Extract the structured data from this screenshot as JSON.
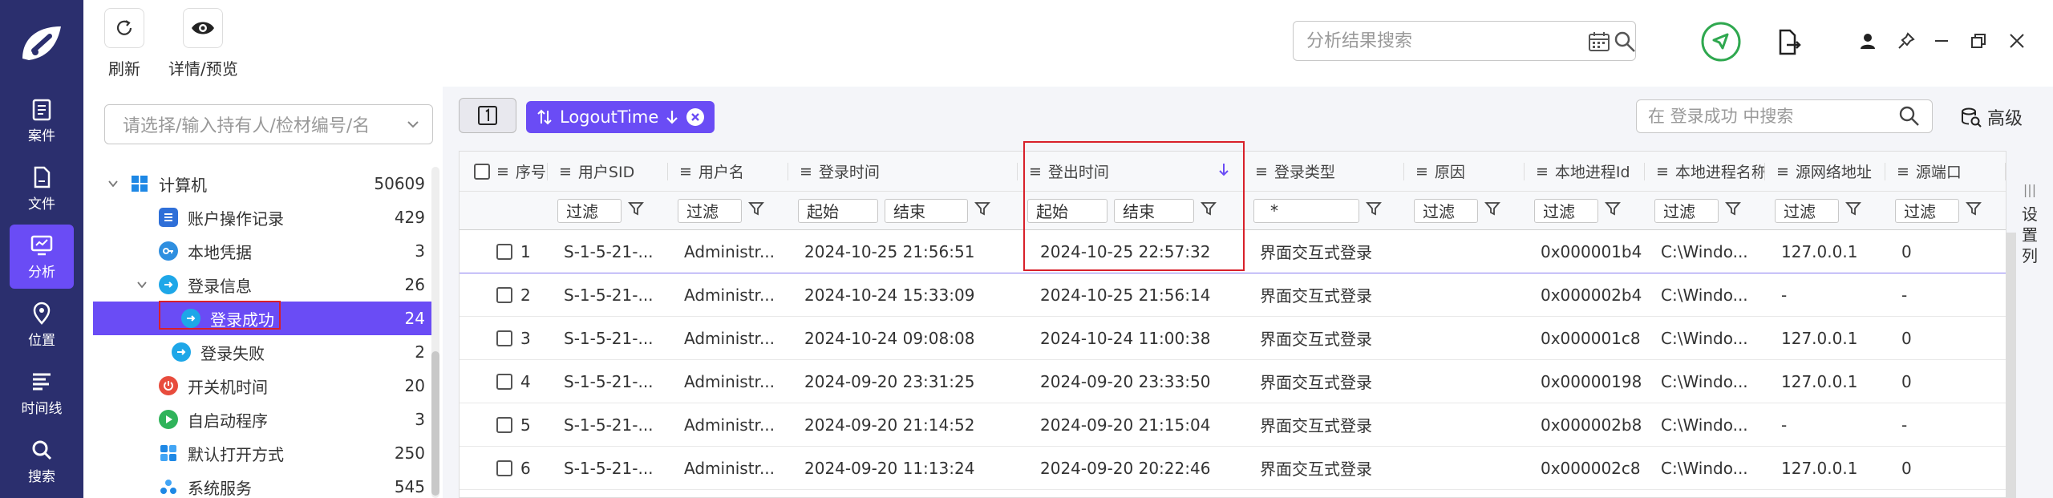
{
  "nav": {
    "items": [
      {
        "label": "案件",
        "icon": "clipboard-icon"
      },
      {
        "label": "文件",
        "icon": "file-icon"
      },
      {
        "label": "分析",
        "icon": "monitor-icon",
        "active": true
      },
      {
        "label": "位置",
        "icon": "location-icon"
      },
      {
        "label": "时间线",
        "icon": "timeline-icon"
      },
      {
        "label": "搜索",
        "icon": "search-icon"
      }
    ]
  },
  "toolbar": {
    "refresh_label": "刷新",
    "detail_label": "详情/预览",
    "search_placeholder": "分析结果搜索"
  },
  "tree": {
    "selector_placeholder": "请选择/输入持有人/检材编号/名",
    "items": [
      {
        "label": "计算机",
        "count": "50609"
      },
      {
        "label": "账户操作记录",
        "count": "429"
      },
      {
        "label": "本地凭据",
        "count": "3"
      },
      {
        "label": "登录信息",
        "count": "26"
      },
      {
        "label": "登录成功",
        "count": "24"
      },
      {
        "label": "登录失败",
        "count": "2"
      },
      {
        "label": "开关机时间",
        "count": "20"
      },
      {
        "label": "自启动程序",
        "count": "3"
      },
      {
        "label": "默认打开方式",
        "count": "250"
      },
      {
        "label": "系统服务",
        "count": "545"
      }
    ]
  },
  "filterbar": {
    "sort_chip_label": "LogoutTime",
    "table_search_placeholder": "在 登录成功 中搜索",
    "advanced_label": "高级"
  },
  "table": {
    "headers": [
      "序号",
      "用户SID",
      "用户名",
      "登录时间",
      "登出时间",
      "登录类型",
      "原因",
      "本地进程Id",
      "本地进程名称",
      "源网络地址",
      "源端口"
    ],
    "filters": {
      "text": "过滤",
      "start": "起始",
      "end": "结束",
      "logon_type": "*"
    },
    "rows": [
      {
        "no": "1",
        "sid": "S-1-5-21-...",
        "user": "Administr...",
        "login": "2024-10-25 21:56:51",
        "logout": "2024-10-25 22:57:32",
        "type": "界面交互式登录",
        "reason": "",
        "pid": "0x000001b4",
        "pname": "C:\\Windo...",
        "addr": "127.0.0.1",
        "port": "0"
      },
      {
        "no": "2",
        "sid": "S-1-5-21-...",
        "user": "Administr...",
        "login": "2024-10-24 15:33:09",
        "logout": "2024-10-25 21:56:14",
        "type": "界面交互式登录",
        "reason": "",
        "pid": "0x000002b4",
        "pname": "C:\\Windo...",
        "addr": "-",
        "port": "-"
      },
      {
        "no": "3",
        "sid": "S-1-5-21-...",
        "user": "Administr...",
        "login": "2024-10-24 09:08:08",
        "logout": "2024-10-24 11:00:38",
        "type": "界面交互式登录",
        "reason": "",
        "pid": "0x000001c8",
        "pname": "C:\\Windo...",
        "addr": "127.0.0.1",
        "port": "0"
      },
      {
        "no": "4",
        "sid": "S-1-5-21-...",
        "user": "Administr...",
        "login": "2024-09-20 23:31:25",
        "logout": "2024-09-20 23:33:50",
        "type": "界面交互式登录",
        "reason": "",
        "pid": "0x00000198",
        "pname": "C:\\Windo...",
        "addr": "127.0.0.1",
        "port": "0"
      },
      {
        "no": "5",
        "sid": "S-1-5-21-...",
        "user": "Administr...",
        "login": "2024-09-20 21:14:52",
        "logout": "2024-09-20 21:15:04",
        "type": "界面交互式登录",
        "reason": "",
        "pid": "0x000002b8",
        "pname": "C:\\Windo...",
        "addr": "-",
        "port": "-"
      },
      {
        "no": "6",
        "sid": "S-1-5-21-...",
        "user": "Administr...",
        "login": "2024-09-20 11:13:24",
        "logout": "2024-09-20 20:22:46",
        "type": "界面交互式登录",
        "reason": "",
        "pid": "0x000002c8",
        "pname": "C:\\Windo...",
        "addr": "127.0.0.1",
        "port": "0"
      }
    ]
  },
  "side": {
    "settings_chars": [
      "设",
      "置",
      "列"
    ]
  },
  "colors": {
    "nav_bg": "#2b2f6e",
    "accent": "#6a4cf5",
    "highlight": "#d8202a",
    "check_green": "#2fa84f"
  }
}
